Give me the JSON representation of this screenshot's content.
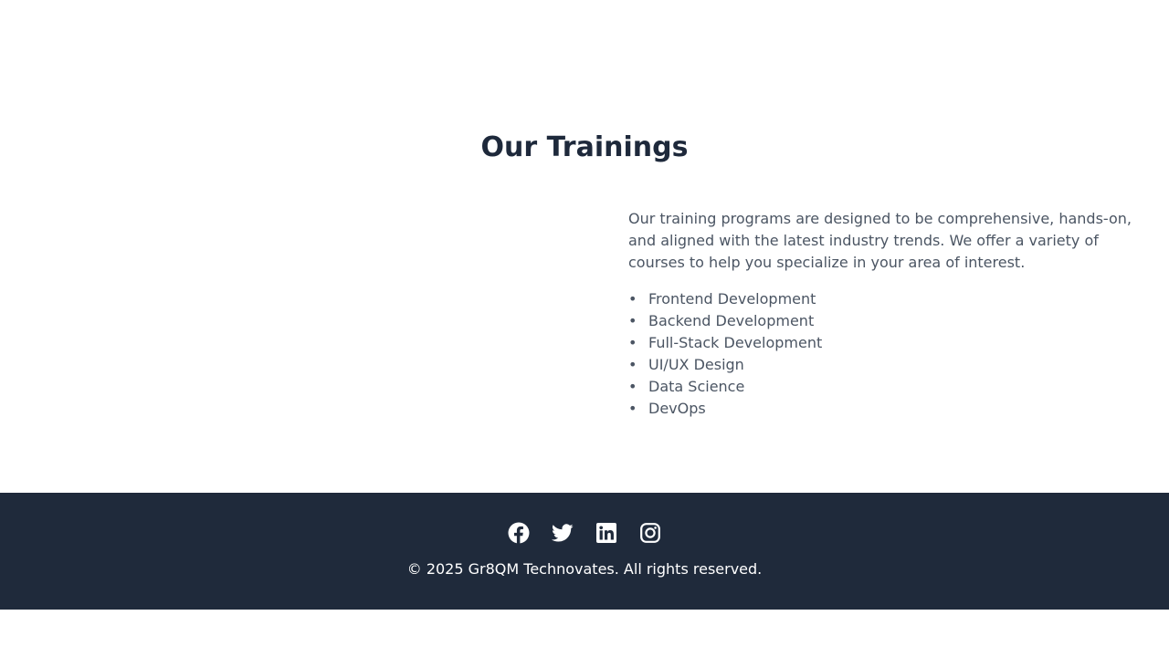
{
  "section": {
    "title": "Our Trainings"
  },
  "trainings": {
    "intro": "Our training programs are designed to be comprehensive, hands-on, and aligned with the latest industry trends. We offer a variety of courses to help you specialize in your area of interest.",
    "bullet": "•",
    "courses": [
      "Frontend Development",
      "Backend Development",
      "Full-Stack Development",
      "UI/UX Design",
      "Data Science",
      "DevOps"
    ]
  },
  "footer": {
    "socials": [
      {
        "icon": "facebook-icon"
      },
      {
        "icon": "twitter-icon"
      },
      {
        "icon": "linkedin-icon"
      },
      {
        "icon": "instagram-icon"
      }
    ],
    "copyright": "© 2025 Gr8QM Technovates. All rights reserved."
  },
  "colors": {
    "heading": "#1e293b",
    "body_text": "#4b5563",
    "footer_bg": "#1f2a3b",
    "footer_text": "#ffffff"
  }
}
